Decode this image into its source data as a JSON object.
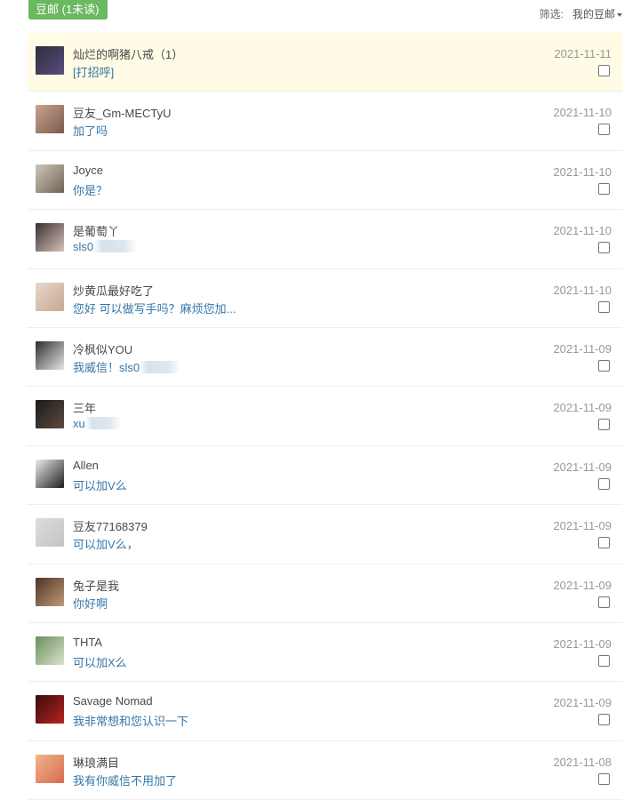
{
  "header": {
    "title": "豆邮 (1未读)",
    "filter_label": "筛选:",
    "filter_value": "我的豆邮"
  },
  "messages": [
    {
      "name": "灿烂的啊猪八戒（1）",
      "text": "[打招呼]",
      "date": "2021-11-11",
      "unread": true,
      "avatar_colors": [
        "#2b2f3c",
        "#5c4b7d"
      ]
    },
    {
      "name": "豆友_Gm-MECTyU",
      "text": "加了吗",
      "date": "2021-11-10",
      "avatar_colors": [
        "#c9a48e",
        "#7a5a4c"
      ]
    },
    {
      "name": "Joyce",
      "text": "你是？",
      "date": "2021-11-10",
      "avatar_colors": [
        "#cfc7b8",
        "#6e6456"
      ]
    },
    {
      "name": "是葡萄丫",
      "text": "sls0",
      "date": "2021-11-10",
      "avatar_colors": [
        "#3a3030",
        "#d6c2b8"
      ]
    },
    {
      "name": "炒黄瓜最好吃了",
      "text": "您好 可以做写手吗？麻烦您加...",
      "date": "2021-11-10",
      "avatar_colors": [
        "#e8d6cc",
        "#c7a892"
      ]
    },
    {
      "name": "冷枫似YOU",
      "text": "我威信！sls0",
      "date": "2021-11-09",
      "avatar_colors": [
        "#2e2e2e",
        "#e6e6e6"
      ]
    },
    {
      "name": "三年",
      "text": "xu",
      "date": "2021-11-09",
      "avatar_colors": [
        "#1b1b1b",
        "#5d4a3f"
      ]
    },
    {
      "name": "Allen",
      "text": "可以加V么",
      "date": "2021-11-09",
      "avatar_colors": [
        "#ececec",
        "#1e1e1e"
      ]
    },
    {
      "name": "豆友77168379",
      "text": "可以加V么，",
      "date": "2021-11-09",
      "avatar_colors": [
        "#dcdcdc",
        "#c4c4c4"
      ]
    },
    {
      "name": "兔子是我",
      "text": "你好啊",
      "date": "2021-11-09",
      "avatar_colors": [
        "#4a3426",
        "#c29a76"
      ]
    },
    {
      "name": "THTA",
      "text": "可以加X么",
      "date": "2021-11-09",
      "avatar_colors": [
        "#6c8f5a",
        "#d8e2cf"
      ]
    },
    {
      "name": "Savage Nomad",
      "text": "我非常想和您认识一下",
      "date": "2021-11-09",
      "avatar_colors": [
        "#3a0d0d",
        "#b82222"
      ]
    },
    {
      "name": "琳琅满目",
      "text": "我有你威信不用加了",
      "date": "2021-11-08",
      "avatar_colors": [
        "#f0b48c",
        "#d86b4f"
      ]
    }
  ]
}
